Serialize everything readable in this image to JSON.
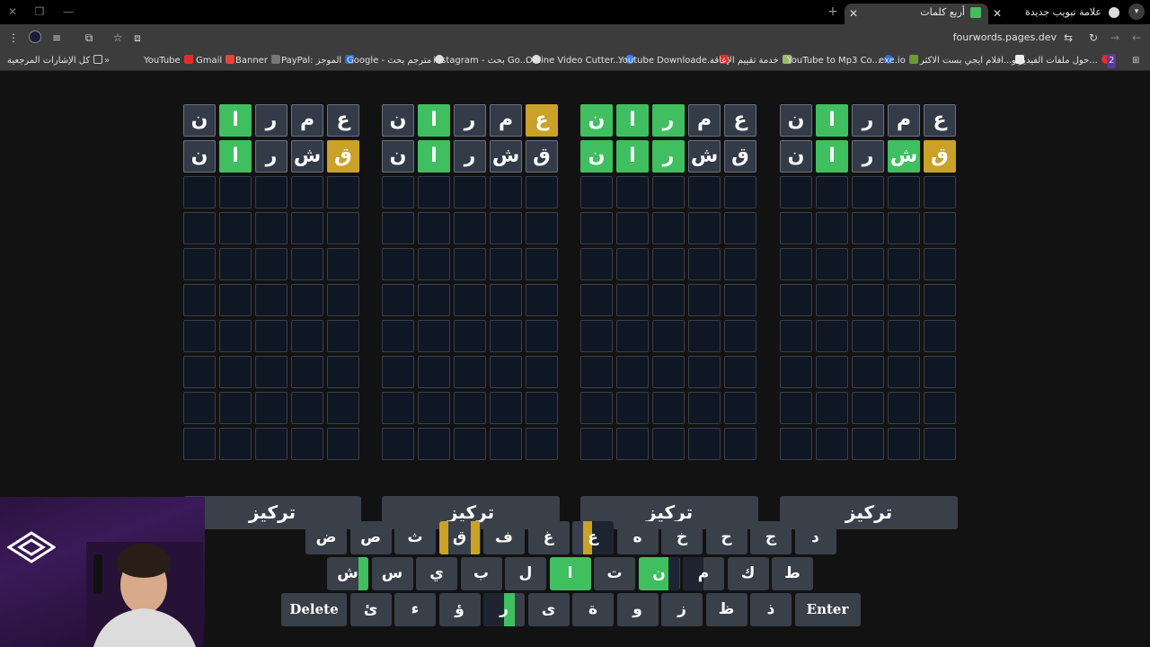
{
  "browser": {
    "tabs": [
      {
        "title": "علامة تبويب جديدة",
        "active": false
      },
      {
        "title": "أربع كلمات",
        "active": true
      }
    ],
    "url": "fourwords.pages.dev",
    "bookmarks": [
      "كل الإشارات المرجعية",
      "YouTube",
      "Gmail",
      "Banner",
      "PayPal: الموجز",
      "Google - مترجم بحث",
      "instagram - بحث Go...",
      "Online Video Cutter...",
      "Youtube Downloade...",
      "خدمة تقييم الإعاقة",
      "YouTube to Mp3 Co...",
      "exe.io",
      "افلام ايجي بست الاكثر...",
      "حول ملفات الفيديو و...",
      "2"
    ],
    "more_bookmarks": "»"
  },
  "game": {
    "focus_label": "تركيز",
    "boards": [
      {
        "rows": [
          [
            {
              "l": "ن",
              "s": "filled"
            },
            {
              "l": "ا",
              "s": "green"
            },
            {
              "l": "ر",
              "s": "filled"
            },
            {
              "l": "م",
              "s": "filled"
            },
            {
              "l": "ع",
              "s": "filled"
            }
          ],
          [
            {
              "l": "ن",
              "s": "filled"
            },
            {
              "l": "ا",
              "s": "green"
            },
            {
              "l": "ر",
              "s": "filled"
            },
            {
              "l": "ش",
              "s": "filled"
            },
            {
              "l": "ق",
              "s": "yellow"
            }
          ]
        ]
      },
      {
        "rows": [
          [
            {
              "l": "ن",
              "s": "filled"
            },
            {
              "l": "ا",
              "s": "green"
            },
            {
              "l": "ر",
              "s": "filled"
            },
            {
              "l": "م",
              "s": "filled"
            },
            {
              "l": "ع",
              "s": "yellow"
            }
          ],
          [
            {
              "l": "ن",
              "s": "filled"
            },
            {
              "l": "ا",
              "s": "green"
            },
            {
              "l": "ر",
              "s": "filled"
            },
            {
              "l": "ش",
              "s": "filled"
            },
            {
              "l": "ق",
              "s": "filled"
            }
          ]
        ]
      },
      {
        "rows": [
          [
            {
              "l": "ن",
              "s": "green"
            },
            {
              "l": "ا",
              "s": "green"
            },
            {
              "l": "ر",
              "s": "green"
            },
            {
              "l": "م",
              "s": "filled"
            },
            {
              "l": "ع",
              "s": "filled"
            }
          ],
          [
            {
              "l": "ن",
              "s": "green"
            },
            {
              "l": "ا",
              "s": "green"
            },
            {
              "l": "ر",
              "s": "green"
            },
            {
              "l": "ش",
              "s": "filled"
            },
            {
              "l": "ق",
              "s": "filled"
            }
          ]
        ]
      },
      {
        "rows": [
          [
            {
              "l": "ن",
              "s": "filled"
            },
            {
              "l": "ا",
              "s": "green"
            },
            {
              "l": "ر",
              "s": "filled"
            },
            {
              "l": "م",
              "s": "filled"
            },
            {
              "l": "ع",
              "s": "filled"
            }
          ],
          [
            {
              "l": "ن",
              "s": "filled"
            },
            {
              "l": "ا",
              "s": "green"
            },
            {
              "l": "ر",
              "s": "filled"
            },
            {
              "l": "ش",
              "s": "green"
            },
            {
              "l": "ق",
              "s": "yellow"
            }
          ]
        ]
      }
    ],
    "total_rows": 10,
    "keyboard": [
      [
        {
          "l": "ض"
        },
        {
          "l": "ص"
        },
        {
          "l": "ث"
        },
        {
          "l": "ق",
          "segs": [
            [
              "#c9a227",
              0,
              0.22
            ],
            [
              "#3a4049",
              0.22,
              0.78
            ],
            [
              "#c9a227",
              0.78,
              1
            ]
          ]
        },
        {
          "l": "ف"
        },
        {
          "l": "غ"
        },
        {
          "l": "ع",
          "segs": [
            [
              "#c9a227",
              0.25,
              0.47
            ],
            [
              "#1f2530",
              0.47,
              1
            ]
          ]
        },
        {
          "l": "ه"
        },
        {
          "l": "خ"
        },
        {
          "l": "ح"
        },
        {
          "l": "ج"
        },
        {
          "l": "د"
        }
      ],
      [
        {
          "l": "ش",
          "segs": [
            [
              "#3fbf5f",
              0.76,
              1
            ]
          ]
        },
        {
          "l": "س"
        },
        {
          "l": "ي"
        },
        {
          "l": "ب"
        },
        {
          "l": "ل"
        },
        {
          "l": "ا",
          "state": "green"
        },
        {
          "l": "ت"
        },
        {
          "l": "ن",
          "segs": [
            [
              "#3fbf5f",
              0,
              0.72
            ],
            [
              "#1f2530",
              0.72,
              1
            ]
          ]
        },
        {
          "l": "م",
          "segs": [
            [
              "#1f2530",
              0,
              0.5
            ]
          ]
        },
        {
          "l": "ك"
        },
        {
          "l": "ط"
        }
      ],
      [
        {
          "l": "Delete",
          "wide": true
        },
        {
          "l": "ئ"
        },
        {
          "l": "ء"
        },
        {
          "l": "ؤ"
        },
        {
          "l": "ر",
          "segs": [
            [
              "#1f2530",
              0,
              0.5
            ],
            [
              "#3fbf5f",
              0.5,
              0.75
            ]
          ]
        },
        {
          "l": "ى"
        },
        {
          "l": "ة"
        },
        {
          "l": "و"
        },
        {
          "l": "ز"
        },
        {
          "l": "ظ"
        },
        {
          "l": "ذ"
        },
        {
          "l": "Enter",
          "wide": true
        }
      ]
    ]
  },
  "colors": {
    "green": "#3fbf5f",
    "yellow": "#c9a227",
    "key": "#3a4049",
    "empty_cell": "#0f1724"
  }
}
